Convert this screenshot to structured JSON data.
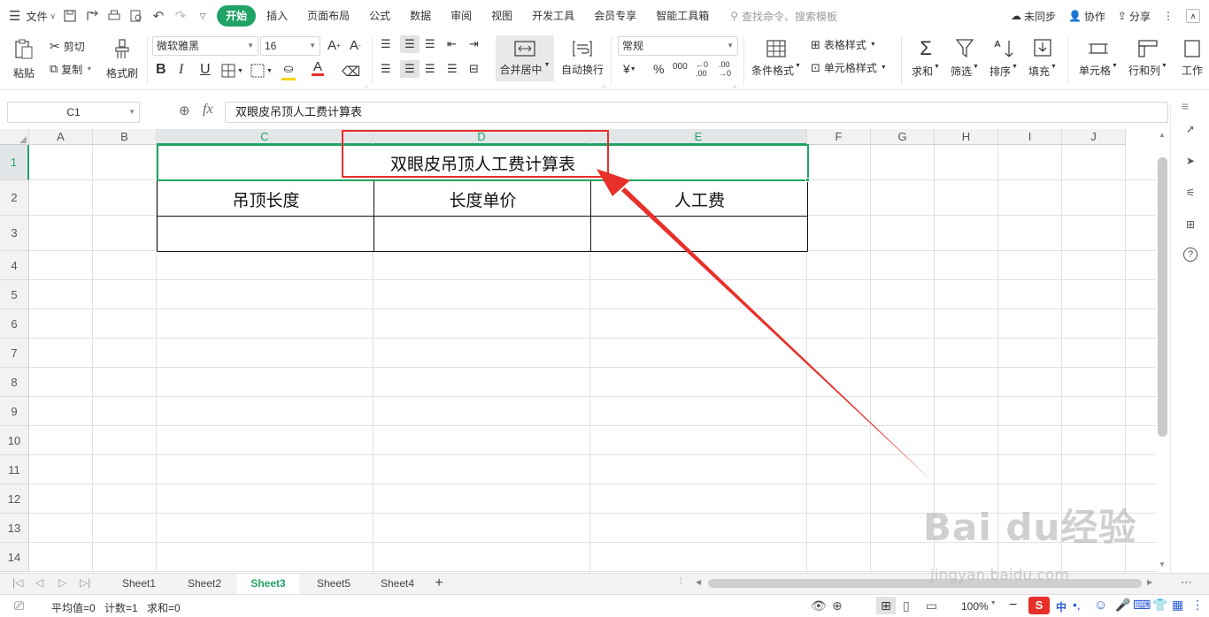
{
  "menubar": {
    "file_label": "文件",
    "tabs": [
      "开始",
      "插入",
      "页面布局",
      "公式",
      "数据",
      "审阅",
      "视图",
      "开发工具",
      "会员专享",
      "智能工具箱"
    ],
    "search_placeholder": "查找命令、搜索模板",
    "sync_label": "未同步",
    "collab_label": "协作",
    "share_label": "分享"
  },
  "toolbar": {
    "paste": "粘贴",
    "cut": "剪切",
    "copy": "复制",
    "format_painter": "格式刷",
    "font_name": "微软雅黑",
    "font_size": "16",
    "merge_center": "合并居中",
    "wrap_text": "自动换行",
    "number_format": "常规",
    "conditional_format": "条件格式",
    "table_style": "表格样式",
    "cell_style": "单元格样式",
    "sum": "求和",
    "filter": "筛选",
    "sort": "排序",
    "fill": "填充",
    "cell": "单元格",
    "row_col": "行和列",
    "worksheet": "工作"
  },
  "formula_bar": {
    "name_box": "C1",
    "fx": "fx",
    "content": "双眼皮吊顶人工费计算表"
  },
  "sheet": {
    "columns": [
      "A",
      "B",
      "C",
      "D",
      "E",
      "F",
      "G",
      "H",
      "I",
      "J"
    ],
    "rows": [
      "1",
      "2",
      "3",
      "4",
      "5",
      "6",
      "7",
      "8",
      "9",
      "10",
      "11",
      "12",
      "13",
      "14"
    ],
    "title": "双眼皮吊顶人工费计算表",
    "headers": [
      "吊顶长度",
      "长度单价",
      "人工费"
    ]
  },
  "tabs": {
    "sheets": [
      "Sheet1",
      "Sheet2",
      "Sheet3",
      "Sheet5",
      "Sheet4"
    ],
    "active": "Sheet3",
    "add": "+"
  },
  "statusbar": {
    "average": "平均值=0",
    "count": "计数=1",
    "sum": "求和=0",
    "zoom": "100%",
    "ime": "中"
  },
  "watermark": {
    "brand": "Bai du经验",
    "url": "jingyan.baidu.com"
  },
  "colors": {
    "accent": "#21a366",
    "annotation": "#e8302a"
  }
}
